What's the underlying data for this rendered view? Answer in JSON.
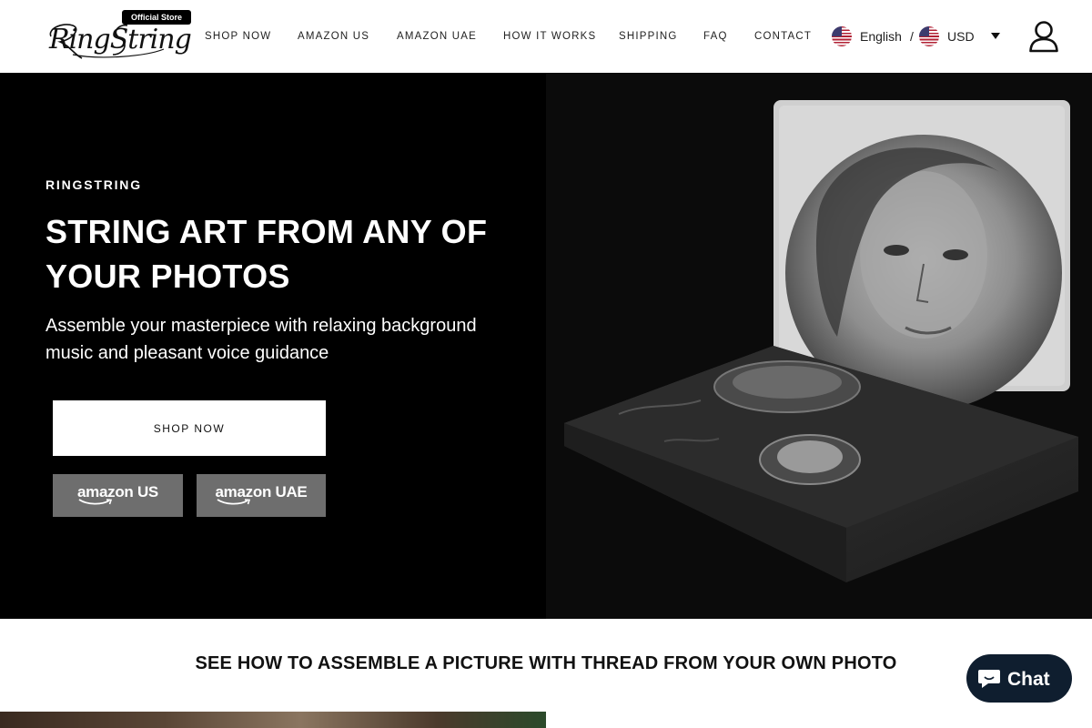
{
  "brand": {
    "badge": "Official Store",
    "logo_text": "RingString"
  },
  "nav": {
    "items": [
      {
        "label": "SHOP NOW"
      },
      {
        "label": "AMAZON US"
      },
      {
        "label": "AMAZON UAE"
      },
      {
        "label": "HOW IT WORKS"
      },
      {
        "label": "SHIPPING"
      },
      {
        "label": "FAQ"
      },
      {
        "label": "CONTACT"
      }
    ]
  },
  "locale": {
    "language": "English",
    "separator": "/",
    "currency": "USD",
    "flag_icon": "us-flag-icon"
  },
  "hero": {
    "eyebrow": "RINGSTRING",
    "title": "STRING ART FROM ANY OF YOUR PHOTOS",
    "subtitle": "Assemble your masterpiece with relaxing background music and pleasant voice guidance",
    "shop_button": "SHOP NOW",
    "amazon_us": {
      "brand": "amazon",
      "region": "US"
    },
    "amazon_uae": {
      "brand": "amazon",
      "region": "UAE"
    },
    "image": "string-art-portrait-kit-box"
  },
  "section": {
    "title": "SEE HOW TO ASSEMBLE A PICTURE WITH THREAD FROM YOUR OWN PHOTO"
  },
  "chat": {
    "label": "Chat"
  },
  "colors": {
    "hero_bg": "#000000",
    "amazon_button": "#6e6e6e",
    "chat_bg": "#0f1e2f"
  }
}
